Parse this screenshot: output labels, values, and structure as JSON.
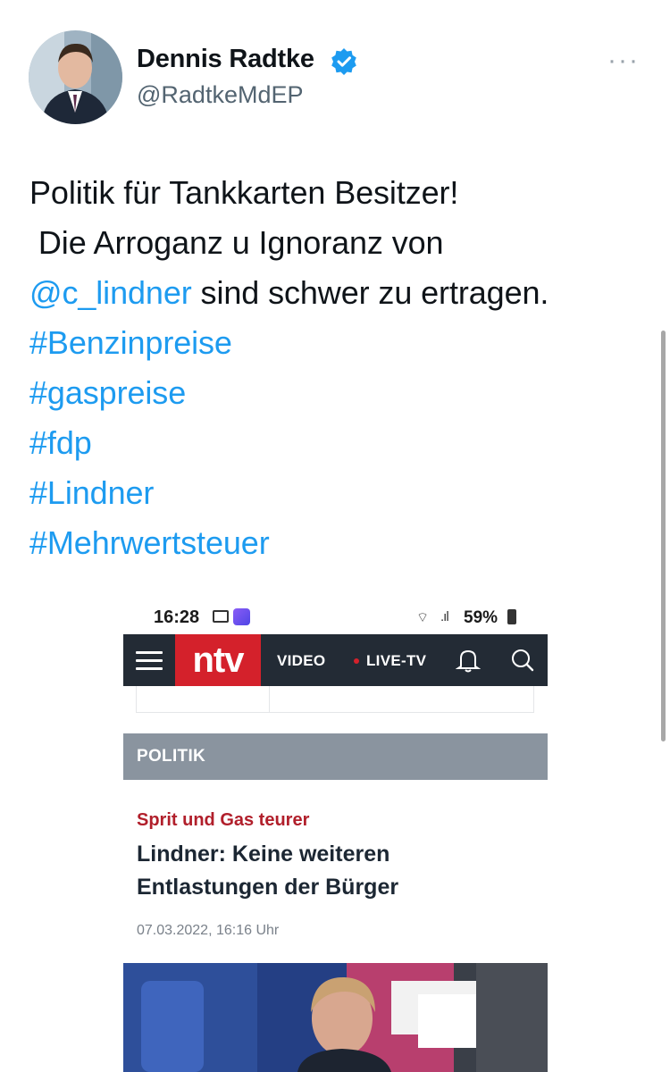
{
  "author": {
    "name": "Dennis Radtke",
    "handle": "@RadtkeMdEP",
    "verified": true,
    "avatar_icon": "profile-photo"
  },
  "more_menu_icon": "ellipsis-icon",
  "tweet": {
    "line1": "Politik für Tankkarten Besitzer!",
    "line2": " Die Arroganz u Ignoranz von",
    "mention": "@c_lindner",
    "line3_rest": " sind schwer zu ertragen.",
    "hashtags": [
      "#Benzinpreise",
      "#gaspreise",
      "#fdp",
      "#Lindner",
      "#Mehrwertsteuer"
    ]
  },
  "embedded_screenshot": {
    "status_bar": {
      "time": "16:28",
      "battery": "59%"
    },
    "nav": {
      "logo": "ntv",
      "video": "VIDEO",
      "live": "LIVE-TV"
    },
    "section": "POLITIK",
    "article": {
      "kicker": "Sprit und Gas teurer",
      "headline": "Lindner: Keine weiteren Entlastungen der Bürger",
      "date": "07.03.2022, 16:16 Uhr"
    }
  },
  "colors": {
    "link": "#1d9bf0",
    "ntv_red": "#d4212b",
    "navbar": "#232b35",
    "section_bar": "#8a949f",
    "kicker": "#b11f2b"
  }
}
